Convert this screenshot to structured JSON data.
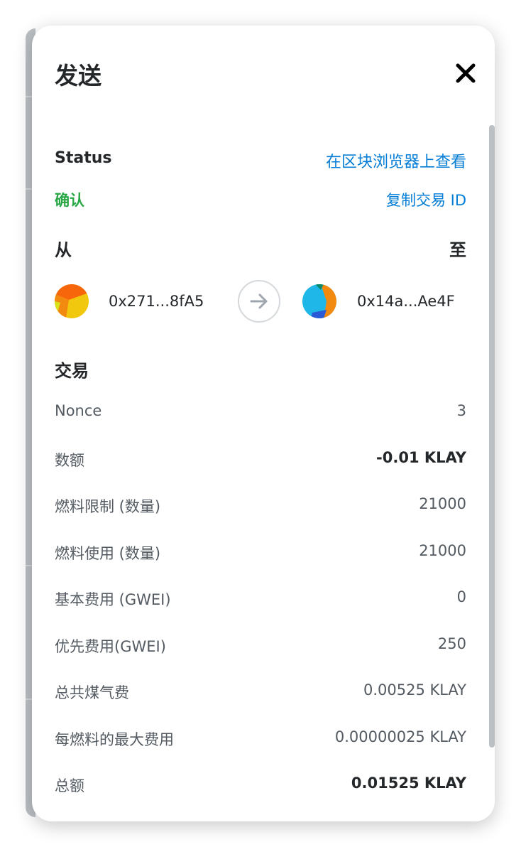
{
  "modal": {
    "title": "发送"
  },
  "status": {
    "label": "Status",
    "value": "确认",
    "view_on_explorer": "在区块浏览器上查看",
    "copy_tx_id": "复制交易 ID"
  },
  "parties": {
    "from_label": "从",
    "to_label": "至",
    "from_address": "0x271...8fA5",
    "to_address": "0x14a...Ae4F"
  },
  "transaction": {
    "title": "交易",
    "rows": [
      {
        "label": "Nonce",
        "value": "3"
      },
      {
        "label": "数额",
        "value": "-0.01 KLAY"
      },
      {
        "label": "燃料限制 (数量)",
        "value": "21000"
      },
      {
        "label": "燃料使用 (数量)",
        "value": "21000"
      },
      {
        "label": "基本费用 (GWEI)",
        "value": "0"
      },
      {
        "label": "优先费用(GWEI)",
        "value": "250"
      },
      {
        "label": "总共煤气费",
        "value": "0.00525 KLAY"
      },
      {
        "label": "每燃料的最大费用",
        "value": "0.00000025 KLAY"
      },
      {
        "label": "总额",
        "value": "0.01525 KLAY"
      }
    ]
  },
  "icons": {
    "close": "close-icon",
    "arrow": "arrow-right-icon",
    "from_avatar": "jazzicon-avatar",
    "to_avatar": "jazzicon-avatar"
  },
  "colors": {
    "link": "#037dd6",
    "status_confirmed": "#28a745",
    "text_primary": "#24272a",
    "text_secondary": "#535a61"
  }
}
